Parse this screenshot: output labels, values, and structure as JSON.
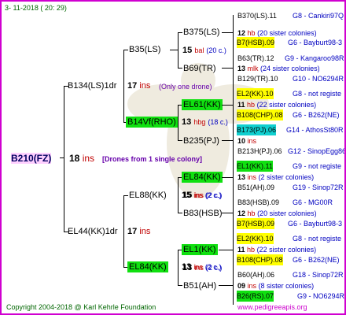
{
  "date": "3- 11-2018 ( 20: 29)",
  "copyright": "Copyright 2004-2018 @ Karl Kehrle Foundation",
  "website": "www.pedigreeapis.org",
  "root": {
    "name": "B210(FZ)",
    "ins_num": "18",
    "ins_word": "ins",
    "note": "[Drones from 1 single colony]"
  },
  "gen1": {
    "upper": {
      "name": "B134(LS)1dr",
      "ins_num": "17",
      "ins_word": "ins",
      "note": "(Only one drone)"
    },
    "lower": {
      "name": "EL44(KK)1dr",
      "ins_num": "17",
      "ins_word": "ins"
    }
  },
  "gen2": {
    "b35": {
      "name": "B35(LS)"
    },
    "b14": {
      "name": "B14Vf(RHO)",
      "ins_num": "13",
      "ins_word": "hbg",
      "note": "(18 c.)"
    },
    "el88": {
      "name": "EL88(KK)",
      "ins_num": "15",
      "ins_word": "ins",
      "note": "(2 c.)"
    },
    "el84": {
      "name": "EL84(KK)",
      "ins_num": "13",
      "ins_word": "ins",
      "note": "(2 c.)"
    }
  },
  "gen3": {
    "b375": {
      "name": "B375(LS)",
      "ins_num": "15",
      "ins_word": "bal",
      "note": "(20 c.)"
    },
    "b69": {
      "name": "B69(TR)"
    },
    "el61": {
      "name": "EL61(KK)"
    },
    "b235": {
      "name": "B235(PJ)"
    },
    "el84b": {
      "name": "EL84(KK)",
      "ins_num": "15",
      "ins_word": "ins",
      "note": "(2 c.)"
    },
    "b83": {
      "name": "B83(HSB)"
    },
    "el1": {
      "name": "EL1(KK)",
      "ins_num": "13",
      "ins_word": "ins",
      "note": "(2 c.)"
    },
    "b51": {
      "name": "B51(AH)"
    }
  },
  "gen4": [
    {
      "parent": "B370(LS).11",
      "parent_info": "G8 - Cankiri97Q",
      "ins_num": "12",
      "ins_text": "hb",
      "ins_note": "(20 sister colonies)",
      "mate": "B7(HSB).09",
      "mate_info": "G6 - Bayburt98-3"
    },
    {
      "parent": "B63(TR).12",
      "parent_info": "G9 - Kangaroo98R",
      "ins_num": "13",
      "ins_text": "mlk",
      "ins_note": "(24 sister colonies)",
      "mate": "B129(TR).10",
      "mate_info": "G10 - NO6294R"
    },
    {
      "parent": "EL2(KK).10",
      "parent_info": "G8 - not registe",
      "ins_num": "11",
      "ins_text": "hb",
      "ins_note": "(22 sister colonies)",
      "mate": "B108(CHP).08",
      "mate_info": "G6 - B262(NE)"
    },
    {
      "parent": "B173(PJ).06",
      "parent_info": "G14 - AthosSt80R",
      "ins_num": "10",
      "ins_text": "ins",
      "ins_note": "",
      "mate": "B213H(PJ).06",
      "mate_info": "G12 - SinopEgg86R"
    },
    {
      "parent": "EL1(KK).11",
      "parent_info": "G9 - not registe",
      "ins_num": "13",
      "ins_text": "ins",
      "ins_note": "(2 sister colonies)",
      "mate": "B51(AH).09",
      "mate_info": "G19 - Sinop72R"
    },
    {
      "parent": "B83(HSB).09",
      "parent_info": "G6 - MG00R",
      "ins_num": "12",
      "ins_text": "hb",
      "ins_note": "(20 sister colonies)",
      "mate": "B7(HSB).09",
      "mate_info": "G6 - Bayburt98-3"
    },
    {
      "parent": "EL2(KK).10",
      "parent_info": "G8 - not registe",
      "ins_num": "11",
      "ins_text": "hb",
      "ins_note": "(22 sister colonies)",
      "mate": "B108(CHP).08",
      "mate_info": "G6 - B262(NE)"
    },
    {
      "parent": "B60(AH).06",
      "parent_info": "G18 - Sinop72R",
      "ins_num": "09",
      "ins_text": "ins",
      "ins_note": "(8 sister colonies)",
      "mate": "B26(RS).07",
      "mate_info": "G9 - NO6294R"
    }
  ]
}
